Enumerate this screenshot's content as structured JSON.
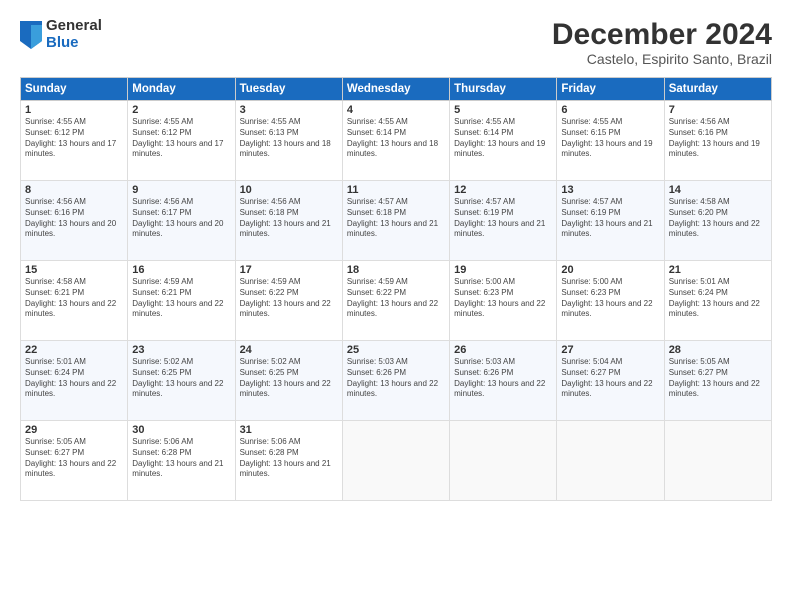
{
  "header": {
    "logo_general": "General",
    "logo_blue": "Blue",
    "main_title": "December 2024",
    "subtitle": "Castelo, Espirito Santo, Brazil"
  },
  "days_of_week": [
    "Sunday",
    "Monday",
    "Tuesday",
    "Wednesday",
    "Thursday",
    "Friday",
    "Saturday"
  ],
  "weeks": [
    [
      {
        "day": "1",
        "info": "Sunrise: 4:55 AM\nSunset: 6:12 PM\nDaylight: 13 hours and 17 minutes."
      },
      {
        "day": "2",
        "info": "Sunrise: 4:55 AM\nSunset: 6:12 PM\nDaylight: 13 hours and 17 minutes."
      },
      {
        "day": "3",
        "info": "Sunrise: 4:55 AM\nSunset: 6:13 PM\nDaylight: 13 hours and 18 minutes."
      },
      {
        "day": "4",
        "info": "Sunrise: 4:55 AM\nSunset: 6:14 PM\nDaylight: 13 hours and 18 minutes."
      },
      {
        "day": "5",
        "info": "Sunrise: 4:55 AM\nSunset: 6:14 PM\nDaylight: 13 hours and 19 minutes."
      },
      {
        "day": "6",
        "info": "Sunrise: 4:55 AM\nSunset: 6:15 PM\nDaylight: 13 hours and 19 minutes."
      },
      {
        "day": "7",
        "info": "Sunrise: 4:56 AM\nSunset: 6:16 PM\nDaylight: 13 hours and 19 minutes."
      }
    ],
    [
      {
        "day": "8",
        "info": "Sunrise: 4:56 AM\nSunset: 6:16 PM\nDaylight: 13 hours and 20 minutes."
      },
      {
        "day": "9",
        "info": "Sunrise: 4:56 AM\nSunset: 6:17 PM\nDaylight: 13 hours and 20 minutes."
      },
      {
        "day": "10",
        "info": "Sunrise: 4:56 AM\nSunset: 6:18 PM\nDaylight: 13 hours and 21 minutes."
      },
      {
        "day": "11",
        "info": "Sunrise: 4:57 AM\nSunset: 6:18 PM\nDaylight: 13 hours and 21 minutes."
      },
      {
        "day": "12",
        "info": "Sunrise: 4:57 AM\nSunset: 6:19 PM\nDaylight: 13 hours and 21 minutes."
      },
      {
        "day": "13",
        "info": "Sunrise: 4:57 AM\nSunset: 6:19 PM\nDaylight: 13 hours and 21 minutes."
      },
      {
        "day": "14",
        "info": "Sunrise: 4:58 AM\nSunset: 6:20 PM\nDaylight: 13 hours and 22 minutes."
      }
    ],
    [
      {
        "day": "15",
        "info": "Sunrise: 4:58 AM\nSunset: 6:21 PM\nDaylight: 13 hours and 22 minutes."
      },
      {
        "day": "16",
        "info": "Sunrise: 4:59 AM\nSunset: 6:21 PM\nDaylight: 13 hours and 22 minutes."
      },
      {
        "day": "17",
        "info": "Sunrise: 4:59 AM\nSunset: 6:22 PM\nDaylight: 13 hours and 22 minutes."
      },
      {
        "day": "18",
        "info": "Sunrise: 4:59 AM\nSunset: 6:22 PM\nDaylight: 13 hours and 22 minutes."
      },
      {
        "day": "19",
        "info": "Sunrise: 5:00 AM\nSunset: 6:23 PM\nDaylight: 13 hours and 22 minutes."
      },
      {
        "day": "20",
        "info": "Sunrise: 5:00 AM\nSunset: 6:23 PM\nDaylight: 13 hours and 22 minutes."
      },
      {
        "day": "21",
        "info": "Sunrise: 5:01 AM\nSunset: 6:24 PM\nDaylight: 13 hours and 22 minutes."
      }
    ],
    [
      {
        "day": "22",
        "info": "Sunrise: 5:01 AM\nSunset: 6:24 PM\nDaylight: 13 hours and 22 minutes."
      },
      {
        "day": "23",
        "info": "Sunrise: 5:02 AM\nSunset: 6:25 PM\nDaylight: 13 hours and 22 minutes."
      },
      {
        "day": "24",
        "info": "Sunrise: 5:02 AM\nSunset: 6:25 PM\nDaylight: 13 hours and 22 minutes."
      },
      {
        "day": "25",
        "info": "Sunrise: 5:03 AM\nSunset: 6:26 PM\nDaylight: 13 hours and 22 minutes."
      },
      {
        "day": "26",
        "info": "Sunrise: 5:03 AM\nSunset: 6:26 PM\nDaylight: 13 hours and 22 minutes."
      },
      {
        "day": "27",
        "info": "Sunrise: 5:04 AM\nSunset: 6:27 PM\nDaylight: 13 hours and 22 minutes."
      },
      {
        "day": "28",
        "info": "Sunrise: 5:05 AM\nSunset: 6:27 PM\nDaylight: 13 hours and 22 minutes."
      }
    ],
    [
      {
        "day": "29",
        "info": "Sunrise: 5:05 AM\nSunset: 6:27 PM\nDaylight: 13 hours and 22 minutes."
      },
      {
        "day": "30",
        "info": "Sunrise: 5:06 AM\nSunset: 6:28 PM\nDaylight: 13 hours and 21 minutes."
      },
      {
        "day": "31",
        "info": "Sunrise: 5:06 AM\nSunset: 6:28 PM\nDaylight: 13 hours and 21 minutes."
      },
      {
        "day": "",
        "info": ""
      },
      {
        "day": "",
        "info": ""
      },
      {
        "day": "",
        "info": ""
      },
      {
        "day": "",
        "info": ""
      }
    ]
  ]
}
